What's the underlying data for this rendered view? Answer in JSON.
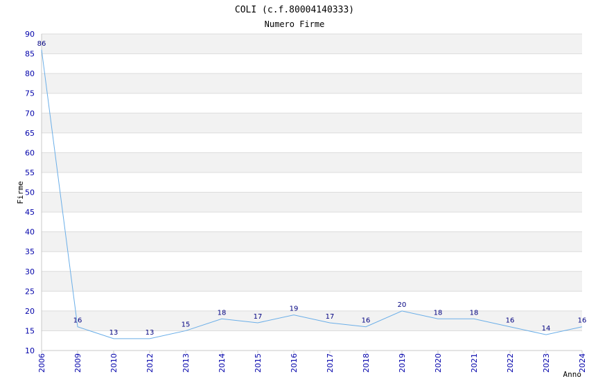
{
  "colors": {
    "band": "#f2f2f2",
    "grid": "#dcdcdc",
    "axis": "#c8c8c8",
    "line": "#6aaee8",
    "tick_text": "#0000aa",
    "label_text": "#000080"
  },
  "chart_data": {
    "type": "line",
    "title": "COLI (c.f.80004140333)",
    "subtitle": "Numero Firme",
    "xlabel": "Anno",
    "ylabel": "Firme",
    "ylim": [
      10,
      90
    ],
    "ytick_step": 5,
    "grid": true,
    "banded_background": true,
    "categories": [
      "2006",
      "2009",
      "2010",
      "2012",
      "2013",
      "2014",
      "2015",
      "2016",
      "2017",
      "2018",
      "2019",
      "2020",
      "2021",
      "2022",
      "2023",
      "2024"
    ],
    "values": [
      86,
      16,
      13,
      13,
      15,
      18,
      17,
      19,
      17,
      16,
      20,
      18,
      18,
      16,
      14,
      16
    ]
  }
}
